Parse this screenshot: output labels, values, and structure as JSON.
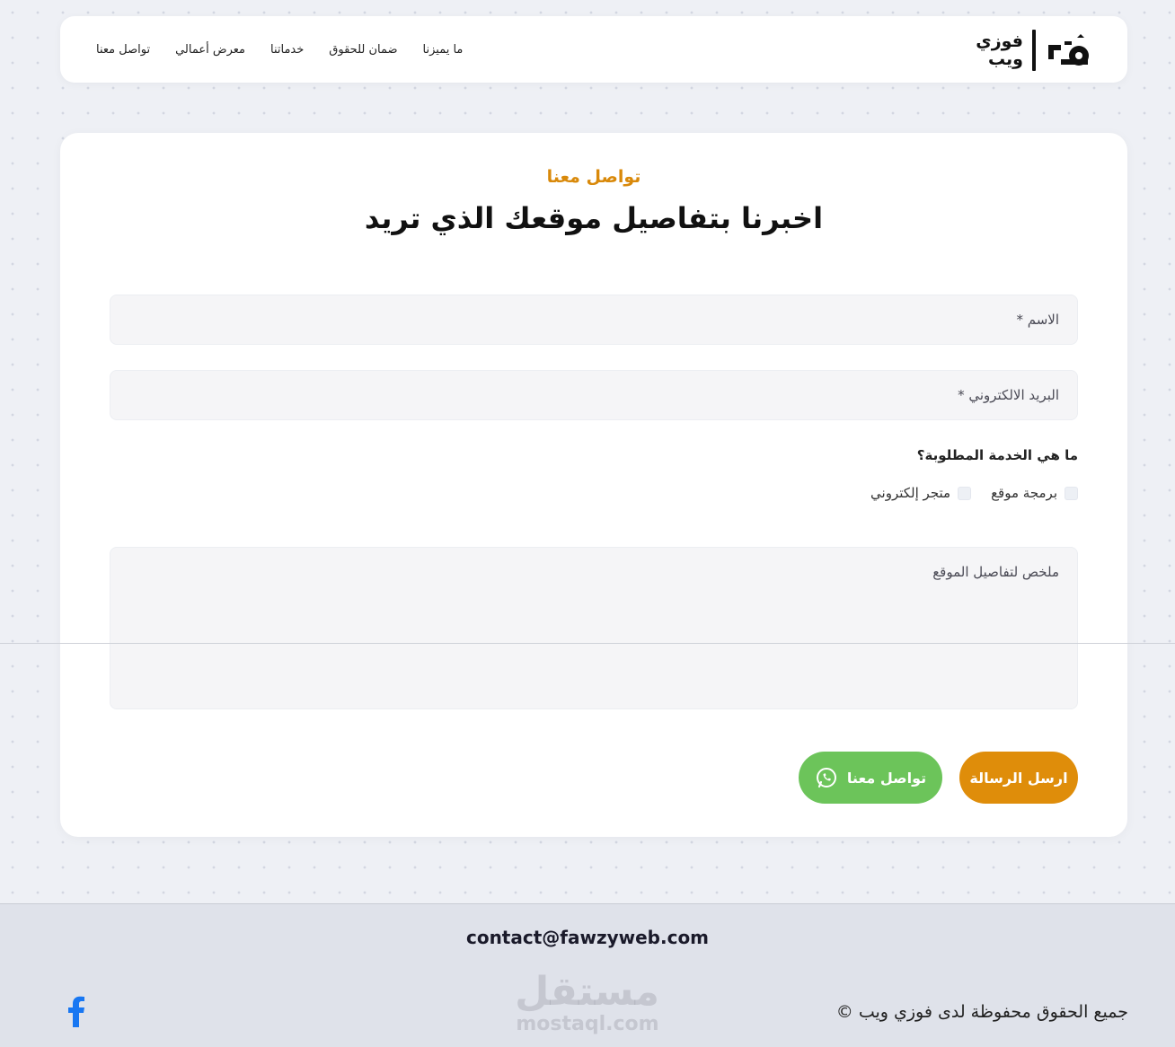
{
  "brand": {
    "logo_line1": "فوزي",
    "logo_line2": "ويب"
  },
  "nav": {
    "items": [
      "ما يميزنا",
      "ضمان للحقوق",
      "خدماتنا",
      "معرض أعمالي",
      "تواصل معنا"
    ]
  },
  "form": {
    "eyebrow": "تواصل معنا",
    "title": "اخبرنا بتفاصيل موقعك الذي تريد",
    "name_placeholder": "الاسم *",
    "email_placeholder": "البريد الالكتروني *",
    "question": "ما هي الخدمة المطلوبة؟",
    "options": [
      {
        "label": "برمجة موقع",
        "checked": false
      },
      {
        "label": "متجر إلكتروني",
        "checked": false
      }
    ],
    "summary_placeholder": "ملخص لتفاصيل الموقع",
    "send_label": "ارسل الرسالة",
    "whatsapp_label": "تواصل معنا"
  },
  "footer": {
    "email": "contact@fawzyweb.com",
    "copyright": "جميع الحقوق محفوظة لدى فوزي ويب ©",
    "watermark_ar": "مستقل",
    "watermark_en": "mostaql.com"
  },
  "colors": {
    "accent_orange": "#df8d0a",
    "whatsapp_green": "#6cc45a",
    "facebook_blue": "#1877f2"
  }
}
